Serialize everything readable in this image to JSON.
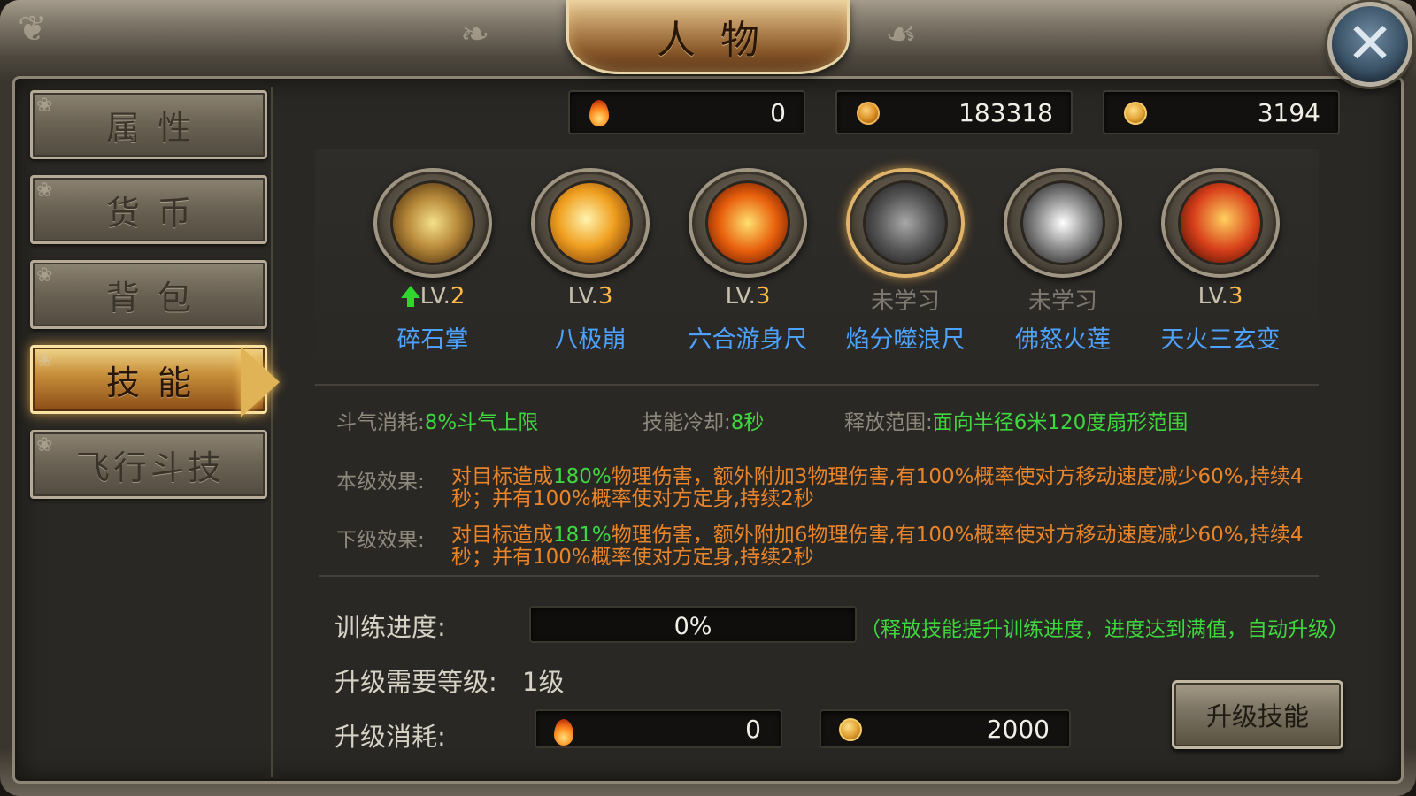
{
  "window": {
    "title": "人物",
    "close_icon": "close-icon"
  },
  "sidebar": {
    "items": [
      {
        "label": "属性",
        "active": false
      },
      {
        "label": "货币",
        "active": false
      },
      {
        "label": "背包",
        "active": false
      },
      {
        "label": "技能",
        "active": true
      },
      {
        "label": "飞行斗技",
        "active": false
      }
    ]
  },
  "currency": [
    {
      "icon": "flame-icon",
      "value": "0"
    },
    {
      "icon": "lock-coin-icon",
      "value": "183318"
    },
    {
      "icon": "gold-coin-icon",
      "value": "3194"
    }
  ],
  "skills": [
    {
      "name": "碎石掌",
      "level_prefix": "LV.",
      "level": "2",
      "learned": true,
      "upgradable": true,
      "selected": false,
      "color": "#b88a3a"
    },
    {
      "name": "八极崩",
      "level_prefix": "LV.",
      "level": "3",
      "learned": true,
      "upgradable": false,
      "selected": false,
      "color": "#f0a020"
    },
    {
      "name": "六合游身尺",
      "level_prefix": "LV.",
      "level": "3",
      "learned": true,
      "upgradable": false,
      "selected": false,
      "color": "#e8600c"
    },
    {
      "name": "焰分噬浪尺",
      "level_text": "未学习",
      "learned": false,
      "selected": true,
      "color": "#6b6b6b"
    },
    {
      "name": "佛怒火莲",
      "level_text": "未学习",
      "learned": false,
      "selected": false,
      "color": "#9a9a9a"
    },
    {
      "name": "天火三玄变",
      "level_prefix": "LV.",
      "level": "3",
      "learned": true,
      "upgradable": false,
      "selected": false,
      "color": "#d8401a"
    }
  ],
  "info": {
    "cost_label": "斗气消耗:",
    "cost_value": "8%斗气上限",
    "cooldown_label": "技能冷却:",
    "cooldown_value": "8秒",
    "range_label": "释放范围:",
    "range_value": "面向半径6米120度扇形范围"
  },
  "effects": {
    "current_label": "本级效果:",
    "current_pre": "对目标造成",
    "current_pct": "180%",
    "current_post": "物理伤害，额外附加3物理伤害,有100%概率使对方移动速度减少60%,持续4秒；并有100%概率使对方定身,持续2秒",
    "next_label": "下级效果:",
    "next_pre": "对目标造成",
    "next_pct": "181%",
    "next_post": "物理伤害，额外附加6物理伤害,有100%概率使对方移动速度减少60%,持续4秒；并有100%概率使对方定身,持续2秒"
  },
  "training": {
    "label": "训练进度:",
    "progress_text": "0%",
    "progress_fraction": 0,
    "hint": "（释放技能提升训练进度，进度达到满值，自动升级）"
  },
  "requirement": {
    "label": "升级需要等级:",
    "value": "1级"
  },
  "upgrade_cost": {
    "label": "升级消耗:",
    "items": [
      {
        "icon": "flame-icon",
        "value": "0"
      },
      {
        "icon": "gold-coin-icon",
        "value": "2000"
      }
    ]
  },
  "upgrade_button": {
    "label": "升级技能"
  }
}
